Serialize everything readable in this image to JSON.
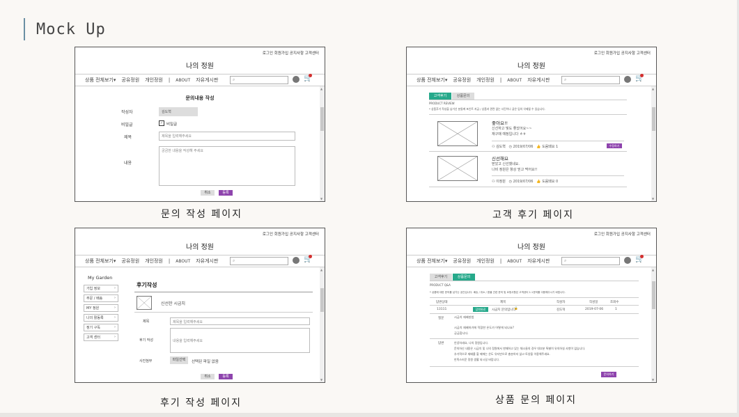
{
  "slide": {
    "title": "Mock Up"
  },
  "common": {
    "top_links": "로그인 회원가입 공지사항 고객센터",
    "logo": "나의 정원",
    "nav_items": [
      "상품 전체보기▾",
      "공유정원",
      "개인정원",
      "|",
      "ABOUT",
      "자유게시판"
    ],
    "search_icon": "⌕",
    "user_icon": "user-icon",
    "cart_icon": "🛒"
  },
  "inquiry_write": {
    "caption": "문의 작성 페이지",
    "heading": "문의내용 작성",
    "author_label": "작성자",
    "author_value": "김도혁",
    "secret_label": "비밀글",
    "secret_check_label": "비밀글",
    "title_label": "제목",
    "title_placeholder": "제목을 입력해주세요",
    "content_label": "내용",
    "content_placeholder": "궁금한 내용을 작성해 주세요",
    "cancel": "취소",
    "submit": "등록"
  },
  "customer_review": {
    "caption": "고객 후기 페이지",
    "tab_review": "고객후기",
    "tab_qna": "상품문의",
    "section_label": "PRODUCT REVIEW",
    "notice": "* 상품후기 작성을 남기신 분들께 포인트 지급 / 상품과 관련 없는 사진이나 글은 임의 삭제될 수 있습니다.",
    "reviews": [
      {
        "title": "좋아요!!",
        "body1": "신선하고 빛도 좋았어요~~",
        "body2": "재구매 예정입니다 ㅎㅎ",
        "author": "김도혁",
        "date": "2019/07/06",
        "likes": "도움돼요 1",
        "button": "수정하기"
      },
      {
        "title": "신선해요",
        "body1": "받았고 신선했네요.",
        "body2": "나비 정원은 항상 믿고 먹어요!!",
        "author": "이정원",
        "date": "2019/07/06",
        "likes": "도움돼요 0",
        "button": ""
      }
    ]
  },
  "review_write": {
    "caption": "후기 작성 페이지",
    "side_title": "My Garden",
    "side_items": [
      "가입 정보",
      "주문 / 배송",
      "MY 정원",
      "나의 활동록",
      "정기 구독",
      "고객 센터"
    ],
    "heading": "후기작성",
    "product_name": "신선한 시금치",
    "title_label": "제목",
    "title_placeholder": "제목을 입력해주세요",
    "content_label": "후기 작성",
    "content_placeholder": "내용을 입력해주세요",
    "photo_label": "사진첨부",
    "photo_button": "파일선택",
    "photo_status": "선택된 파일 없음",
    "cancel": "취소",
    "submit": "등록"
  },
  "product_qna": {
    "caption": "상품 문의 페이지",
    "tab_review": "고객후기",
    "tab_qna": "상품문의",
    "section_label": "PRODUCT Q&A",
    "notice": "* 상품에 대한 문의를 남기는 공간입니다. 배송 / 취소 / 환불 관련 문의 및 요청사항은 고객센터 1:1문의를 이용해주시기 바랍니다.",
    "headers": [
      "답변상태",
      "제목",
      "작성자",
      "작성일",
      "조회수"
    ],
    "row": {
      "no": "13111",
      "status": "답변완료",
      "title": "시금치 문의입니다",
      "lock": "🔒",
      "author": "김도혁",
      "date": "2019-07-06",
      "views": "1"
    },
    "question_label": "질문",
    "question_lines": [
      "시금치 재배방법",
      "시금치 재배하기에 적합한 온도가 어떻게 되나요?",
      "궁금합니다."
    ],
    "answer_label": "답변",
    "answer_lines": [
      "안녕하세요, 나의 정원입니다.",
      "문의하신 내용은 시금치 및 나의 정원에서 판매하고 있는 채소들의 경우 대부분 특별히 유의하실 사항이 없습니다.",
      "추가적으로 재배를 할 때에는 온도 유지만으로 충분하지 않고 토양을 이용해주세요.",
      "만족스러운 정원 생활 되시길 바랍니다."
    ],
    "write_button": "문의하기"
  },
  "colors": {
    "accent_green": "#26a98b",
    "accent_purple": "#8e44ad",
    "badge_red": "#d32f2f"
  }
}
